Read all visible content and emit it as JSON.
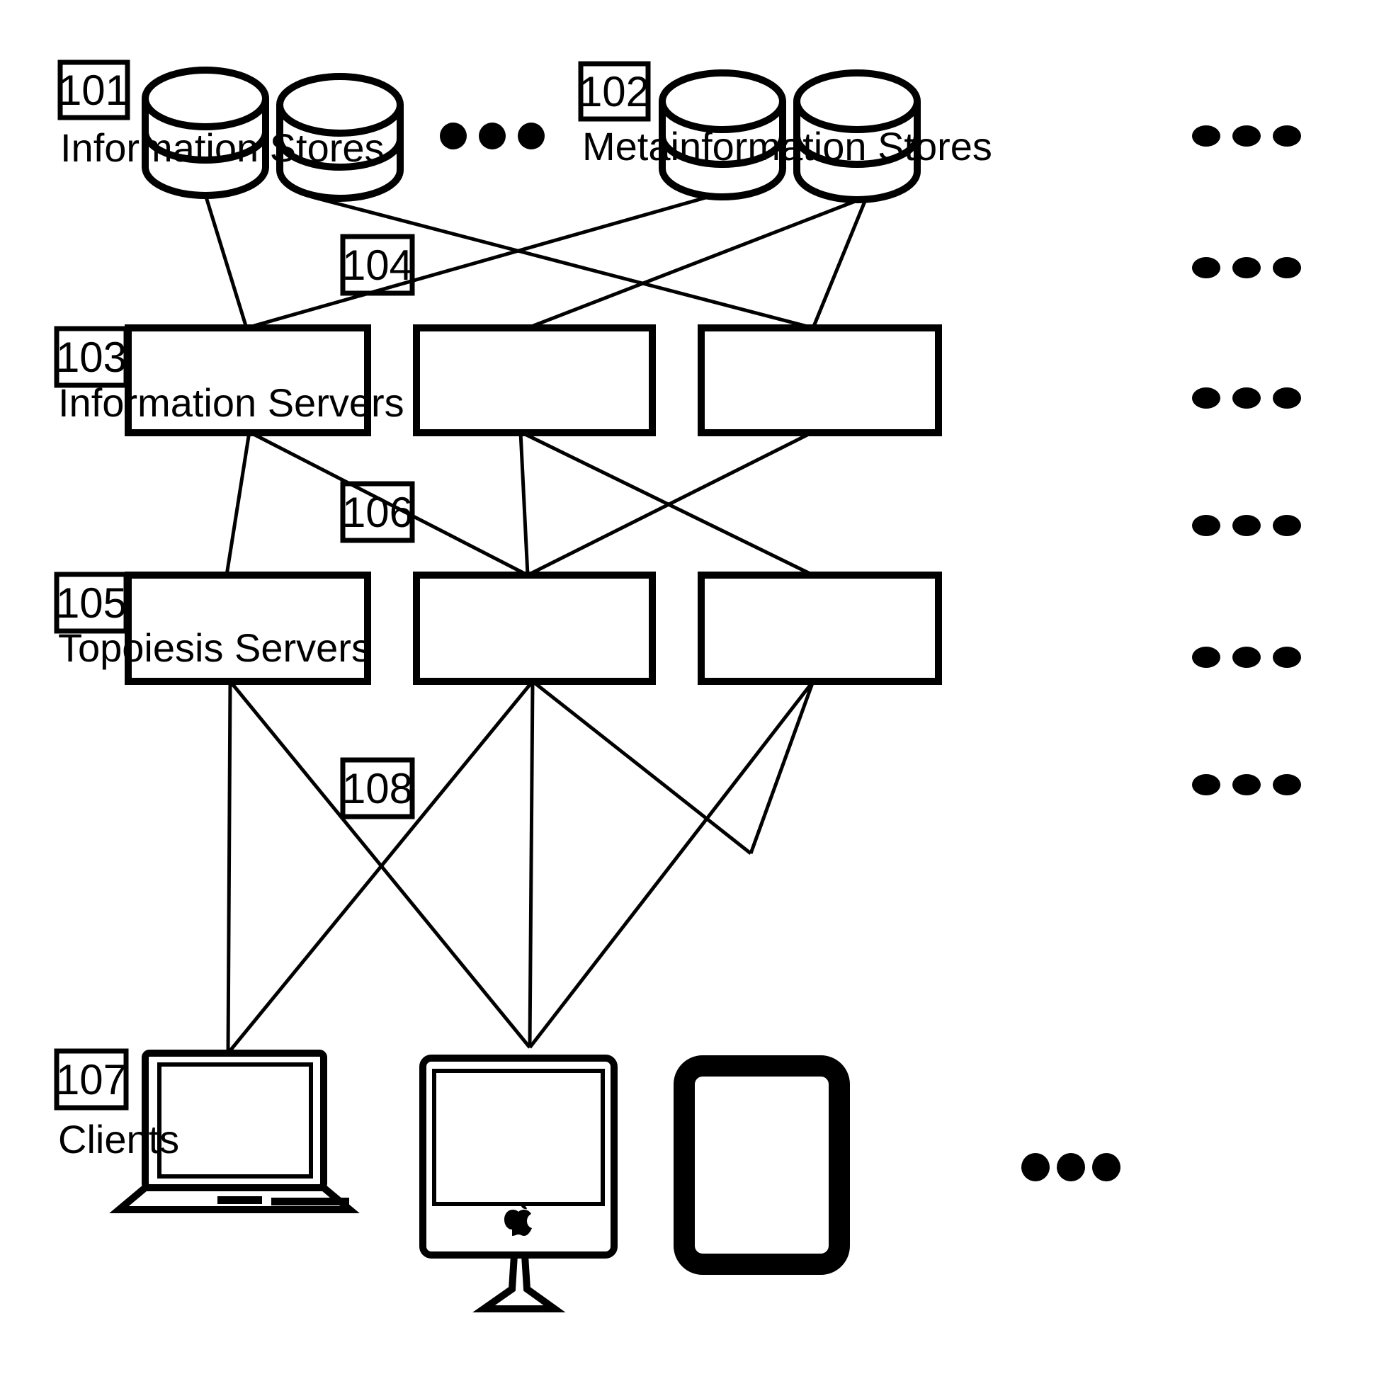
{
  "figure": {
    "type": "patent-architecture-diagram",
    "background_color": "#ffffff",
    "line_color": "#000000"
  },
  "tiers": [
    {
      "ref": "101",
      "label": "Information Stores",
      "element_kind": "database-cylinder",
      "count_shown": 2,
      "has_ellipsis": true
    },
    {
      "ref": "102",
      "label": "Metainformation Stores",
      "element_kind": "database-cylinder",
      "count_shown": 2,
      "has_ellipsis": true
    },
    {
      "ref": "103",
      "label": "Information Servers",
      "element_kind": "server-rectangle",
      "count_shown": 3,
      "has_ellipsis": true
    },
    {
      "ref": "105",
      "label": "Topoiesis Servers",
      "element_kind": "server-rectangle",
      "count_shown": 3,
      "has_ellipsis": true
    },
    {
      "ref": "107",
      "label": "Clients",
      "element_kind": "client-device",
      "count_shown": 3,
      "has_ellipsis": true,
      "devices": [
        "laptop",
        "desktop-imac",
        "tablet"
      ]
    }
  ],
  "connector_refs": [
    {
      "ref": "104",
      "between": "Information/Metainformation Stores and Information Servers"
    },
    {
      "ref": "106",
      "between": "Information Servers and Topoiesis Servers"
    },
    {
      "ref": "108",
      "between": "Topoiesis Servers and Clients"
    }
  ],
  "ref_numbers": [
    "101",
    "102",
    "103",
    "104",
    "105",
    "106",
    "107",
    "108"
  ],
  "ellipsis": {
    "glyph": "•••",
    "dot_count": 3,
    "right_column_rows": 6,
    "inline_rows": 2
  }
}
